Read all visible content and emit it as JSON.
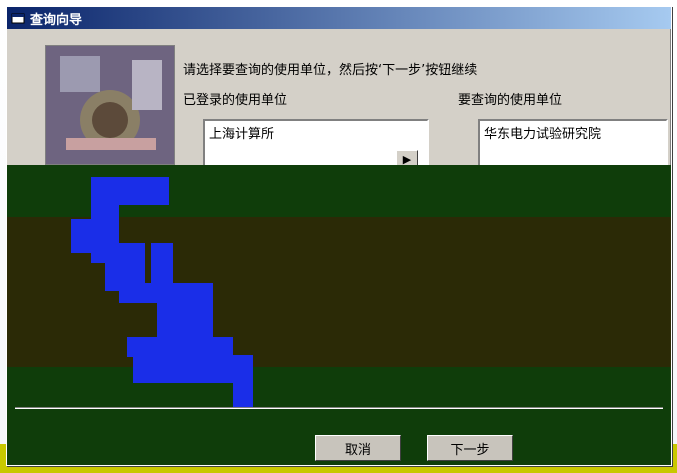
{
  "window": {
    "title": "查询向导"
  },
  "instructions": "请选择要查询的使用单位，然后按‘下一步’按钮继续",
  "registered_units": {
    "label": "已登录的使用单位",
    "items": [
      "上海计算所"
    ]
  },
  "query_units": {
    "label": "要查询的使用单位",
    "items": [
      "华东电力试验研究院"
    ]
  },
  "buttons": {
    "move": "▶",
    "cancel": "取消",
    "next": "下一步"
  },
  "colors": {
    "titlebar_start": "#0a246a",
    "dialog_face": "#d4d0c8"
  }
}
